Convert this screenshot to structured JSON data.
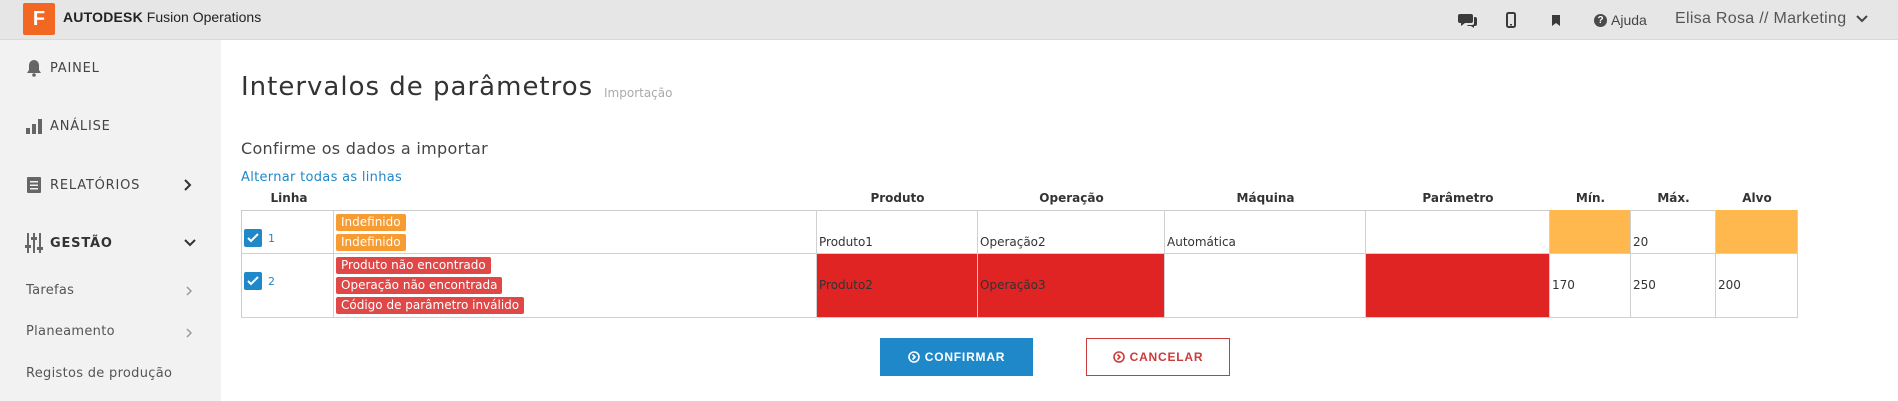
{
  "header": {
    "brand": "AUTODESK",
    "product": "Fusion Operations",
    "logo_letter": "F",
    "help_label": "Ajuda",
    "user_label": "Elisa Rosa // Marketing"
  },
  "sidebar": {
    "items": [
      {
        "label": "PAINEL"
      },
      {
        "label": "ANÁLISE"
      },
      {
        "label": "RELATÓRIOS"
      },
      {
        "label": "GESTÃO"
      }
    ],
    "sub_items": [
      {
        "label": "Tarefas"
      },
      {
        "label": "Planeamento"
      },
      {
        "label": "Registos de produção"
      }
    ]
  },
  "main": {
    "title": "Intervalos de parâmetros",
    "subtitle": "Importação",
    "section_title": "Confirme os dados a importar",
    "toggle_link": "Alternar todas as linhas",
    "columns": {
      "linha": "Linha",
      "produto": "Produto",
      "operacao": "Operação",
      "maquina": "Máquina",
      "parametro": "Parâmetro",
      "min": "Mín.",
      "max": "Máx.",
      "alvo": "Alvo"
    },
    "rows": [
      {
        "num": "1",
        "checked": true,
        "badges": [
          "Indefinido",
          "Indefinido"
        ],
        "produto": "Produto1",
        "operacao": "Operação2",
        "maquina": "Automática",
        "parametro": "",
        "min": "",
        "max": "20",
        "alvo": ""
      },
      {
        "num": "2",
        "checked": true,
        "badges": [
          "Produto não encontrado",
          "Operação não encontrada",
          "Código de parâmetro inválido"
        ],
        "produto": "Produto2",
        "operacao": "Operação3",
        "maquina": "",
        "parametro": "",
        "min": "170",
        "max": "250",
        "alvo": "200"
      }
    ],
    "confirm_label": "CONFIRMAR",
    "cancel_label": "CANCELAR"
  },
  "colors": {
    "accent": "#1f88c9",
    "warning": "#ffb84d",
    "error": "#e02424",
    "brand": "#f26722"
  },
  "icons": {
    "chat": "chat-icon",
    "mobile": "mobile-icon",
    "bookmark": "bookmark-icon",
    "help": "help-icon",
    "bell": "bell-icon",
    "chart": "chart-icon",
    "reports": "reports-icon",
    "settings": "sliders-icon"
  }
}
